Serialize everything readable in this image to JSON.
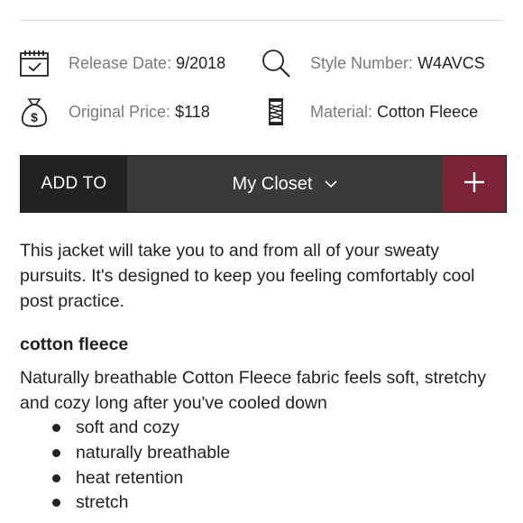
{
  "details": {
    "release_date": {
      "label": "Release Date:",
      "value": "9/2018",
      "icon": "calendar-icon"
    },
    "style_number": {
      "label": "Style Number:",
      "value": "W4AVCS",
      "icon": "search-icon"
    },
    "original_price": {
      "label": "Original Price:",
      "value": "$118",
      "icon": "money-bag-icon"
    },
    "material": {
      "label": "Material:",
      "value": "Cotton Fleece",
      "icon": "yarn-spool-icon"
    }
  },
  "actions": {
    "add_to_label": "ADD TO",
    "closet_select_value": "My Closet",
    "plus_symbol": "+"
  },
  "description": {
    "text": "This jacket will take you to and from all of your sweaty pursuits. It's designed to keep you feeling comfortably cool post practice.",
    "section_heading": "cotton fleece",
    "section_body": "Naturally breathable Cotton Fleece fabric feels soft, stretchy and cozy long after you've cooled down",
    "bullets": [
      "soft and cozy",
      "naturally breathable",
      "heat retention",
      "stretch"
    ]
  },
  "colors": {
    "add_to_bg": "#222222",
    "select_bg": "#3a3a3a",
    "plus_bg": "#7c2237",
    "label_gray": "#7a7a7a"
  }
}
